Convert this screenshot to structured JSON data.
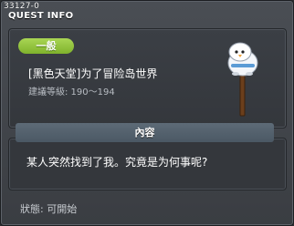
{
  "window": {
    "quest_id": "33127-0",
    "title": "QUEST INFO"
  },
  "quest": {
    "category": "一般",
    "name": "[黑色天堂]为了冒险岛世界",
    "level": "建議等級: 190～194"
  },
  "content": {
    "header": "內容",
    "text": "某人突然找到了我。究竟是为何事呢?"
  },
  "status": {
    "text": "狀態: 可開始"
  },
  "colors": {
    "badge_green": "#8cc63f",
    "content_header": "#55626e",
    "window_bg": "#40444a"
  },
  "icons": {
    "npc": "snowman-npc-on-signpost"
  }
}
